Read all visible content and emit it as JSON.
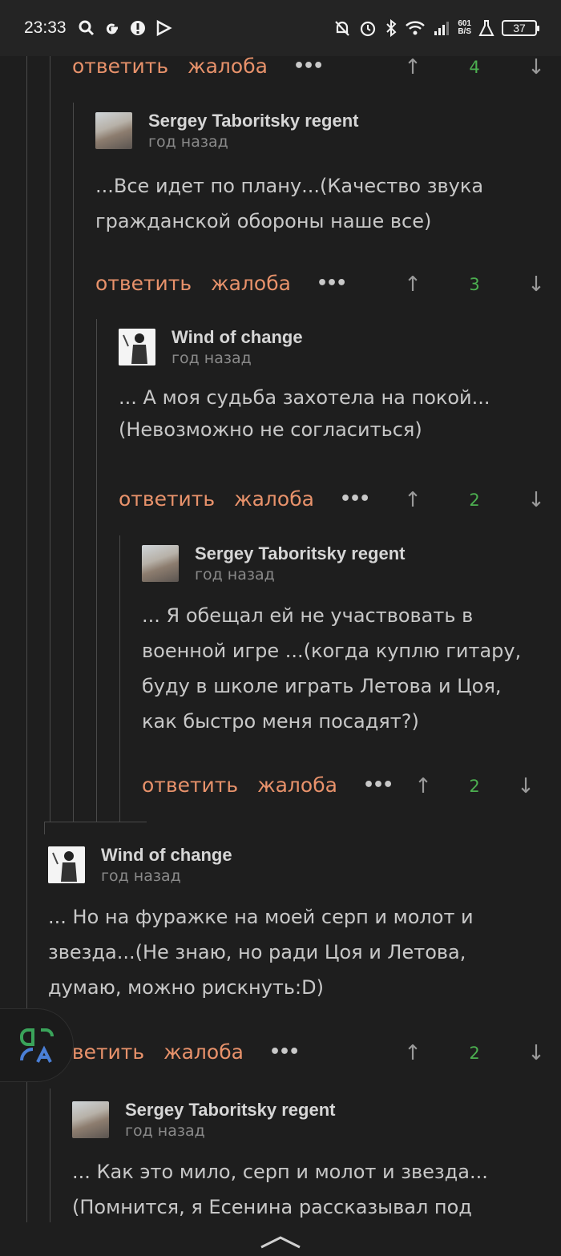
{
  "status_bar": {
    "time": "23:33",
    "net_speed_value": "601",
    "net_speed_unit": "B/S",
    "battery": "37"
  },
  "actions": {
    "reply": "ответить",
    "report": "жалоба",
    "more": "•••"
  },
  "top_actions": {
    "score": "4"
  },
  "comments": [
    {
      "author": "Sergey Taboritsky regent",
      "ago": "год назад",
      "text": "...Все идет по плану...(Качество звука гражданской обороны наше все)",
      "score": "3"
    },
    {
      "author": "Wind of change",
      "ago": "год назад",
      "text": "... А моя судьба захотела на покой...(Невозможно не согласиться)",
      "score": "2"
    },
    {
      "author": "Sergey Taboritsky regent",
      "ago": "год назад",
      "text": "... Я обещал ей не участвовать в военной игре ...(когда куплю гитару, буду в школе играть Летова и Цоя, как быстро меня посадят?)",
      "score": "2"
    },
    {
      "author": "Wind of change",
      "ago": "год назад",
      "text": "... Но на фуражке на моей серп и молот и звезда...(Не знаю, но ради Цоя и Летова, думаю, можно рискнуть:D)",
      "score": "2"
    },
    {
      "author": "Sergey Taboritsky regent",
      "ago": "год назад",
      "text": "... Как это мило, серп и молот и звезда... (Помнится, я Есенина рассказывал под"
    }
  ]
}
